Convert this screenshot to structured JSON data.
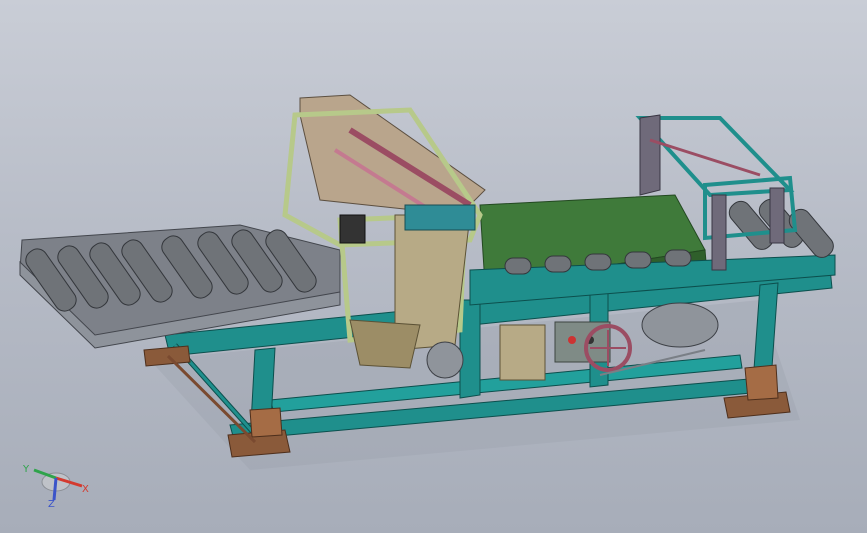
{
  "viewport": {
    "background_top": "#c9cdd6",
    "background_bottom": "#a7adb9"
  },
  "model": {
    "frame_color": "#1f8f8c",
    "conveyor_belt_color": "#3f7a3a",
    "roller_color": "#6f7378",
    "light_frame_color": "#b7c98a",
    "body_color": "#b7aa86",
    "accent_color": "#9b4d63",
    "foot_color": "#8a5a3a"
  },
  "triad": {
    "x_label": "X",
    "y_label": "Y",
    "z_label": "Z",
    "x_color": "#d43a2f",
    "y_color": "#2fa34b",
    "z_color": "#3b54c9"
  }
}
